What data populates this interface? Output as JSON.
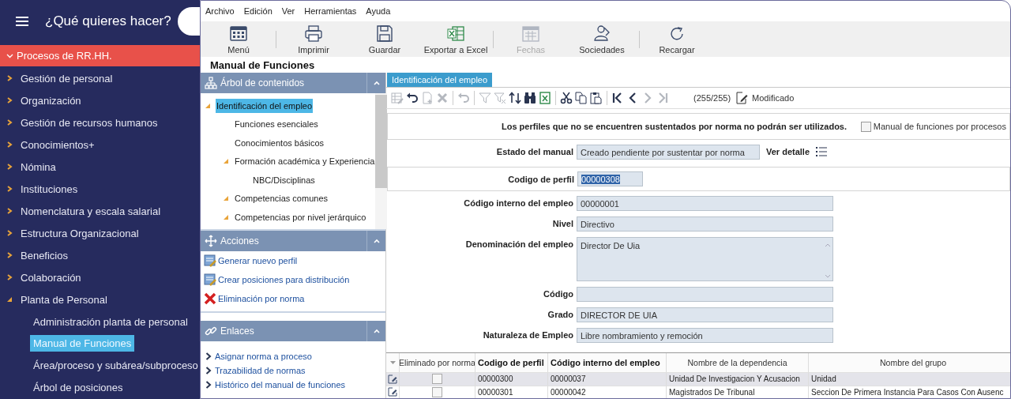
{
  "sidebar": {
    "title": "¿Qué quieres hacer?",
    "group": {
      "label": "Procesos de RR.HH.",
      "expanded": true
    },
    "items": [
      {
        "label": "Gestión de personal",
        "expanded": false
      },
      {
        "label": "Organización",
        "expanded": false
      },
      {
        "label": "Gestión de recursos humanos",
        "expanded": false
      },
      {
        "label": "Conocimientos+",
        "expanded": false
      },
      {
        "label": "Nómina",
        "expanded": false
      },
      {
        "label": "Instituciones",
        "expanded": false
      },
      {
        "label": "Nomenclatura y escala salarial",
        "expanded": false
      },
      {
        "label": "Estructura Organizacional",
        "expanded": false
      },
      {
        "label": "Beneficios",
        "expanded": false
      },
      {
        "label": "Colaboración",
        "expanded": false
      },
      {
        "label": "Planta de Personal",
        "expanded": true,
        "children": [
          {
            "label": "Administración planta de personal",
            "selected": false
          },
          {
            "label": "Manual de Funciones",
            "selected": true
          },
          {
            "label": "Área/proceso y subárea/subproceso",
            "selected": false
          },
          {
            "label": "Árbol de posiciones",
            "selected": false
          }
        ]
      }
    ]
  },
  "menu_bar": [
    "Archivo",
    "Edición",
    "Ver",
    "Herramientas",
    "Ayuda"
  ],
  "toolbar": {
    "groups": [
      [
        {
          "label": "Menú",
          "disabled": false
        }
      ],
      [
        {
          "label": "Imprimir",
          "disabled": false
        },
        {
          "label": "Guardar",
          "disabled": false
        },
        {
          "label": "Exportar a Excel",
          "disabled": false
        }
      ],
      [
        {
          "label": "Fechas",
          "disabled": true
        },
        {
          "label": "Sociedades",
          "disabled": false
        }
      ],
      [
        {
          "label": "Recargar",
          "disabled": false
        }
      ]
    ]
  },
  "page_title": "Manual de Funciones",
  "contents_panel": {
    "title": "Árbol de contenidos",
    "tree": [
      {
        "label": "Identificación del empleo",
        "selected": true,
        "expanded": true,
        "children": [
          {
            "label": "Funciones esenciales",
            "selected": false
          },
          {
            "label": "Conocimientos básicos",
            "selected": false
          },
          {
            "label": "Formación académica y Experiencia",
            "selected": false,
            "expanded": true,
            "children": [
              {
                "label": "NBC/Disciplinas",
                "selected": false
              }
            ]
          },
          {
            "label": "Competencias comunes",
            "selected": false,
            "expanded": true
          },
          {
            "label": "Competencias por nivel jerárquico",
            "selected": false,
            "expanded": true
          }
        ]
      }
    ]
  },
  "actions_panel": {
    "title": "Acciones",
    "items": [
      {
        "label": "Generar nuevo perfil",
        "kind": "wizard"
      },
      {
        "label": "Crear posiciones para distribución",
        "kind": "wizard"
      },
      {
        "label": "Eliminación por norma",
        "kind": "delete"
      }
    ]
  },
  "links_panel": {
    "title": "Enlaces",
    "items": [
      "Asignar norma a proceso",
      "Trazabilidad de normas",
      "Histórico del manual de funciones"
    ]
  },
  "tabs": [
    {
      "label": "Identificación del empleo",
      "selected": true
    }
  ],
  "record_toolbar": {
    "groups": [
      [
        {
          "disabled": true
        },
        {
          "disabled": false
        },
        {
          "disabled": true
        },
        {
          "disabled": true
        }
      ],
      [
        {
          "disabled": true
        }
      ],
      [
        {
          "disabled": true
        },
        {
          "disabled": true
        },
        {
          "disabled": false
        },
        {
          "disabled": false
        },
        {
          "disabled": false
        }
      ],
      [
        {
          "disabled": false
        },
        {
          "disabled": false
        },
        {
          "disabled": false
        }
      ],
      [
        {
          "disabled": false
        },
        {
          "disabled": false
        },
        {
          "disabled": true
        },
        {
          "disabled": true
        }
      ]
    ],
    "counter": "(255/255)",
    "status": "Modificado"
  },
  "form": {
    "notice": "Los perfiles que no se encuentren sustentados por norma no podrán ser utilizados.",
    "process_checkbox": {
      "label": "Manual de funciones por procesos",
      "checked": false
    },
    "state": {
      "label": "Estado del manual",
      "value": "Creado pendiente por sustentar por norma",
      "link": "Ver detalle"
    },
    "profile_code": {
      "label": "Codigo de perfil",
      "value": "00000308"
    },
    "fields": [
      {
        "label": "Código interno del empleo",
        "value": "00000001",
        "kind": "text"
      },
      {
        "label": "Nivel",
        "value": "Directivo",
        "kind": "text"
      },
      {
        "label": "Denominación del empleo",
        "value": "Director De Uia",
        "kind": "textarea"
      },
      {
        "label": "Código",
        "kind": "text"
      },
      {
        "label": "Grado",
        "value": "DIRECTOR DE UIA",
        "kind": "text"
      },
      {
        "label": "Naturaleza de Empleo",
        "value": "Libre nombramiento y remoción",
        "kind": "text"
      }
    ]
  },
  "grid": {
    "columns": [
      {
        "label": "Eliminado por norma",
        "key": false
      },
      {
        "label": "Codigo de perfil",
        "key": true
      },
      {
        "label": "Código interno del empleo",
        "key": true
      },
      {
        "label": "Nombre de la dependencia",
        "key": false
      },
      {
        "label": "Nombre del grupo",
        "key": false
      }
    ],
    "rows": [
      {
        "selected": true,
        "cells": [
          {
            "kind": "checkbox",
            "checked": false
          },
          {
            "kind": "text",
            "text": "00000300"
          },
          {
            "kind": "text",
            "text": "00000037"
          },
          {
            "kind": "text",
            "text": "Unidad De Investigacion Y Acusacion"
          },
          {
            "kind": "text",
            "text": "Unidad"
          }
        ]
      },
      {
        "selected": false,
        "cells": [
          {
            "kind": "checkbox",
            "checked": false
          },
          {
            "kind": "text",
            "text": "00000301"
          },
          {
            "kind": "text",
            "text": "00000042"
          },
          {
            "kind": "text",
            "text": "Magistrados De Tribunal"
          },
          {
            "kind": "text",
            "text": "Seccion De Primera Instancia Para Casos Con Ausenc"
          }
        ]
      }
    ]
  }
}
